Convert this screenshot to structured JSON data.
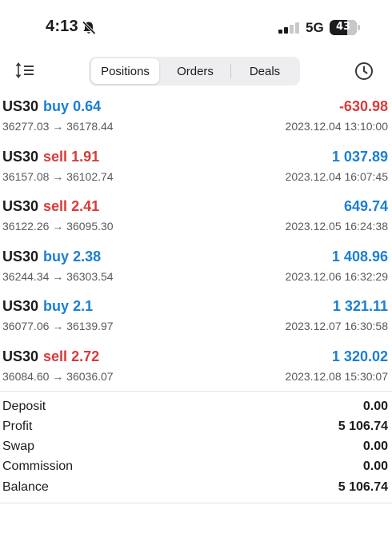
{
  "status_bar": {
    "time": "4:13",
    "network": "5G",
    "battery": "43",
    "icons": [
      "bell-slash-icon",
      "signal-icon",
      "battery-icon"
    ]
  },
  "toolbar": {
    "sort_icon": "sort-icon",
    "history_icon": "clock-icon",
    "tabs": [
      {
        "label": "Positions",
        "selected": true
      },
      {
        "label": "Orders",
        "selected": false
      },
      {
        "label": "Deals",
        "selected": false
      }
    ]
  },
  "colors": {
    "buy": "#1a7fd6",
    "sell": "#d93a3a",
    "profit_positive": "#1a7fd6",
    "profit_negative": "#d93a3a"
  },
  "deals": [
    {
      "symbol": "US30",
      "side": "buy",
      "volume": "0.64",
      "prices": "36277.03 → 36178.44",
      "profit": "-630.98",
      "time": "2023.12.04 13:10:00"
    },
    {
      "symbol": "US30",
      "side": "sell",
      "volume": "1.91",
      "prices": "36157.08 → 36102.74",
      "profit": "1 037.89",
      "time": "2023.12.04 16:07:45"
    },
    {
      "symbol": "US30",
      "side": "sell",
      "volume": "2.41",
      "prices": "36122.26 → 36095.30",
      "profit": "649.74",
      "time": "2023.12.05 16:24:38"
    },
    {
      "symbol": "US30",
      "side": "buy",
      "volume": "2.38",
      "prices": "36244.34 → 36303.54",
      "profit": "1 408.96",
      "time": "2023.12.06 16:32:29"
    },
    {
      "symbol": "US30",
      "side": "buy",
      "volume": "2.1",
      "prices": "36077.06 → 36139.97",
      "profit": "1 321.11",
      "time": "2023.12.07 16:30:58"
    },
    {
      "symbol": "US30",
      "side": "sell",
      "volume": "2.72",
      "prices": "36084.60 → 36036.07",
      "profit": "1 320.02",
      "time": "2023.12.08 15:30:07"
    }
  ],
  "summary": [
    {
      "label": "Deposit",
      "value": "0.00"
    },
    {
      "label": "Profit",
      "value": "5 106.74"
    },
    {
      "label": "Swap",
      "value": "0.00"
    },
    {
      "label": "Commission",
      "value": "0.00"
    },
    {
      "label": "Balance",
      "value": "5 106.74"
    }
  ]
}
